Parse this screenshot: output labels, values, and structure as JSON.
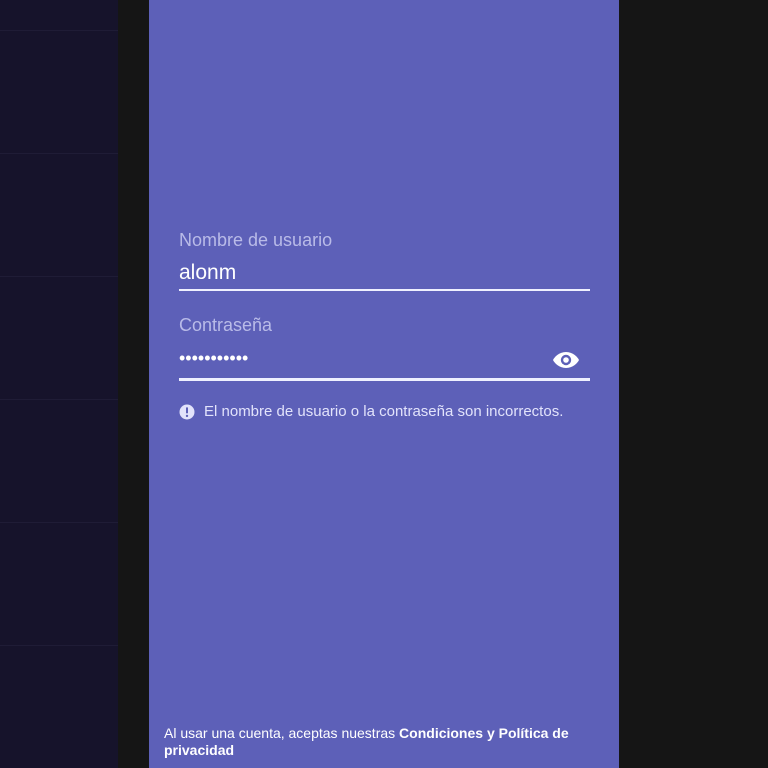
{
  "login": {
    "username_label": "Nombre de usuario",
    "username_value": "alonm",
    "password_label": "Contraseña",
    "password_value": "•••••••••••",
    "show_password_icon": "eye-icon",
    "error_icon": "error-circle-icon",
    "error_message": "El nombre de usuario o la contraseña son incorrectos.",
    "legal_prefix": "Al usar una cuenta, aceptas nuestras ",
    "legal_link": "Condiciones y Política de privacidad"
  },
  "colors": {
    "panel_background": "#5d60b8",
    "label_text": "#b9bbe8",
    "value_text": "#ffffff",
    "background_left": "#16132b",
    "background_right": "#151515"
  }
}
